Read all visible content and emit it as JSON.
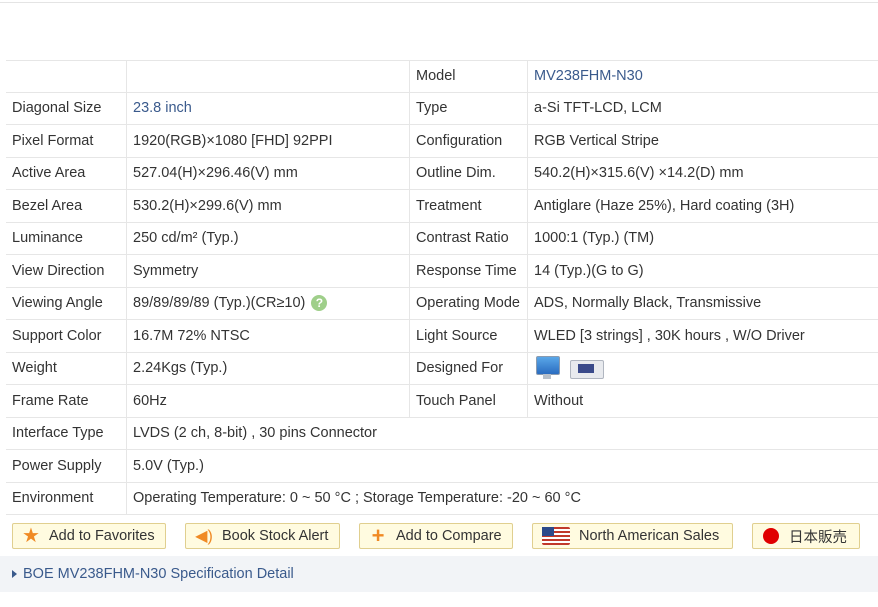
{
  "spec": {
    "rows": [
      {
        "l1": "",
        "v1": "",
        "l2": "Model",
        "v2": "MV238FHM-N30"
      },
      {
        "l1": "Diagonal Size",
        "v1": "23.8 inch",
        "l2": "Type",
        "v2": "a-Si TFT-LCD, LCM"
      },
      {
        "l1": "Pixel Format",
        "v1": "1920(RGB)×1080  [FHD]  92PPI",
        "l2": "Configuration",
        "v2": "RGB Vertical Stripe"
      },
      {
        "l1": "Active Area",
        "v1": "527.04(H)×296.46(V) mm",
        "l2": "Outline Dim.",
        "v2": "540.2(H)×315.6(V) ×14.2(D) mm"
      },
      {
        "l1": "Bezel Area",
        "v1": "530.2(H)×299.6(V) mm",
        "l2": "Treatment",
        "v2": "Antiglare (Haze 25%), Hard coating (3H)"
      },
      {
        "l1": "Luminance",
        "v1": "250 cd/m² (Typ.)",
        "l2": "Contrast Ratio",
        "v2": "1000:1 (Typ.) (TM)"
      },
      {
        "l1": "View Direction",
        "v1": "Symmetry",
        "l2": "Response Time",
        "v2": "14 (Typ.)(G to G)"
      },
      {
        "l1": "Viewing Angle",
        "v1": "89/89/89/89 (Typ.)(CR≥10)",
        "l2": "Operating Mode",
        "v2": "ADS, Normally Black, Transmissive"
      },
      {
        "l1": "Support Color",
        "v1": "16.7M   72% NTSC",
        "l2": "Light Source",
        "v2": "WLED  [3 strings] , 30K hours , W/O Driver"
      },
      {
        "l1": "Weight",
        "v1": "2.24Kgs (Typ.)",
        "l2": "Designed For",
        "v2": ""
      },
      {
        "l1": "Frame Rate",
        "v1": "60Hz",
        "l2": "Touch Panel",
        "v2": "Without"
      }
    ],
    "wide_rows": [
      {
        "label": "Interface Type",
        "value": "LVDS (2 ch, 8-bit) , 30 pins Connector"
      },
      {
        "label": "Power Supply",
        "value": "5.0V (Typ.)"
      },
      {
        "label": "Environment",
        "value": "Operating Temperature: 0 ~ 50 °C ; Storage Temperature: -20 ~ 60 °C"
      }
    ],
    "help_glyph": "?",
    "designed_for_icons": [
      "monitor-icon",
      "industrial-device-icon"
    ]
  },
  "buttons": {
    "favorites": "Add to Favorites",
    "stock_alert": "Book Stock Alert",
    "compare": "Add to Compare",
    "na_sales": "North American Sales",
    "japanese": "日本販売"
  },
  "detail_link": "BOE MV238FHM-N30 Specification Detail",
  "colors": {
    "link_blue": "#3a5a8c",
    "button_bg": "#fffbe0",
    "icon_orange": "#f08a24"
  }
}
